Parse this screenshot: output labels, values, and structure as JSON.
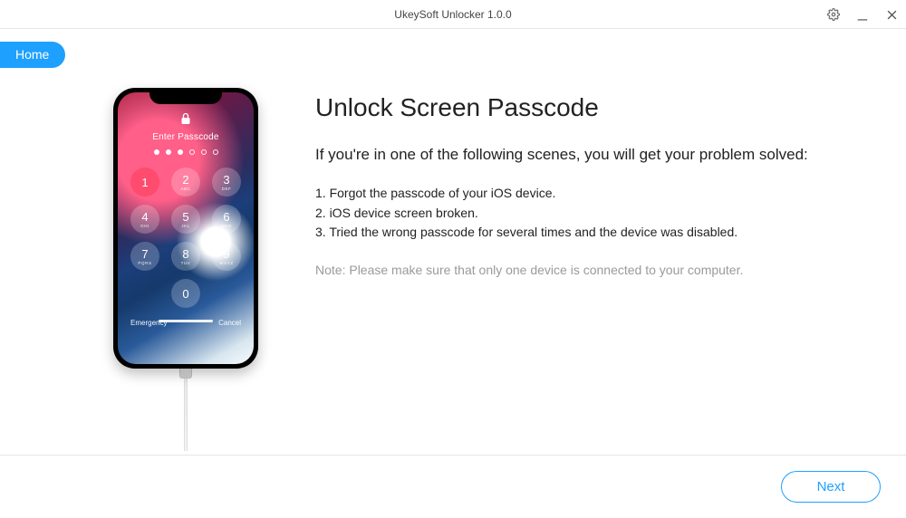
{
  "window": {
    "title": "UkeySoft Unlocker 1.0.0"
  },
  "tabs": {
    "home": "Home"
  },
  "phone": {
    "prompt": "Enter Passcode",
    "emergency": "Emergency",
    "cancel": "Cancel",
    "keys": [
      {
        "n": "1",
        "l": ""
      },
      {
        "n": "2",
        "l": "ABC"
      },
      {
        "n": "3",
        "l": "DEF"
      },
      {
        "n": "4",
        "l": "GHI"
      },
      {
        "n": "5",
        "l": "JKL"
      },
      {
        "n": "6",
        "l": "MNO"
      },
      {
        "n": "7",
        "l": "PQRS"
      },
      {
        "n": "8",
        "l": "TUV"
      },
      {
        "n": "9",
        "l": "WXYZ"
      },
      {
        "n": "0",
        "l": ""
      }
    ]
  },
  "main": {
    "heading": "Unlock Screen Passcode",
    "lead": "If you're in one of the following scenes, you will get your problem solved:",
    "item1": "1. Forgot the passcode of your iOS device.",
    "item2": "2. iOS device screen broken.",
    "item3": "3. Tried the wrong passcode for several times and the device was disabled.",
    "note": "Note: Please make sure that only one device is connected to your computer."
  },
  "footer": {
    "next": "Next"
  }
}
